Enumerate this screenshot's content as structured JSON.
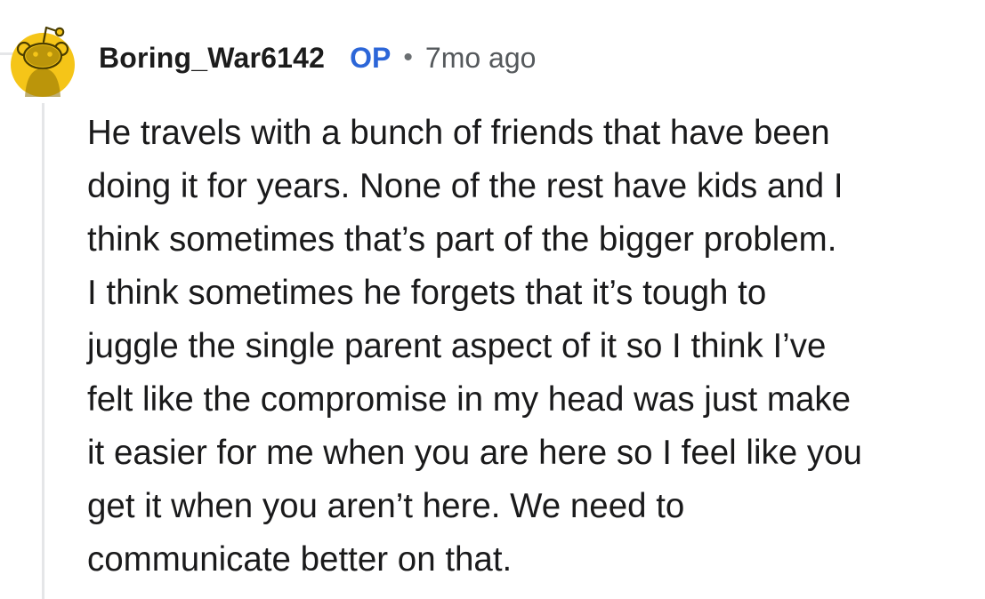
{
  "comment": {
    "author": "Boring_War6142",
    "op_badge": "OP",
    "separator": "•",
    "timestamp": "7mo ago",
    "avatar_icon": "reddit-snoo-avatar-icon",
    "avatar_color": "#f5c518",
    "body_lines": [
      "He travels with a bunch of friends that have been",
      "doing it for years. None of the rest have kids and I",
      "think sometimes that’s part of the bigger problem.",
      "I think sometimes he forgets that it’s tough to",
      "juggle the single parent aspect of it so I think I’ve",
      "felt like the compromise in my head was just make",
      "it easier for me when you are here so I feel like you",
      "get it when you aren’t here. We need to",
      "communicate better on that."
    ]
  },
  "colors": {
    "op_badge": "#2c66d8",
    "thread_line": "#e5e6e8"
  }
}
